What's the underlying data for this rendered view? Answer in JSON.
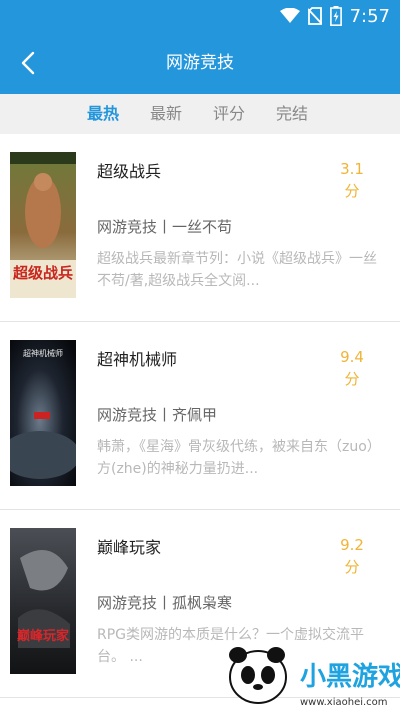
{
  "status_bar": {
    "time": "7:57"
  },
  "header": {
    "title": "网游竞技"
  },
  "tabs": [
    {
      "label": "最热",
      "active": true
    },
    {
      "label": "最新",
      "active": false
    },
    {
      "label": "评分",
      "active": false
    },
    {
      "label": "完结",
      "active": false
    }
  ],
  "books": [
    {
      "title": "超级战兵",
      "score_value": "3.1",
      "score_unit": "分",
      "meta": "网游竞技丨一丝不苟",
      "desc": "超级战兵最新章节列：小说《超级战兵》一丝不苟/著,超级战兵全文阅...",
      "cover_text": "超级战兵"
    },
    {
      "title": "超神机械师",
      "score_value": "9.4",
      "score_unit": "分",
      "meta": "网游竞技丨齐佩甲",
      "desc": "韩萧，《星海》骨灰级代练，被来自东（zuo）方(zhe)的神秘力量扔进...",
      "cover_text": "超神机械师"
    },
    {
      "title": "巅峰玩家",
      "score_value": "9.2",
      "score_unit": "分",
      "meta": "网游竞技丨孤枫枭寒",
      "desc": "RPG类网游的本质是什么？一个虚拟交流平台。 ...",
      "cover_text": "巅峰玩家"
    }
  ],
  "watermark": {
    "brand": "小黑游戏",
    "url": "www.xiaohei.com"
  },
  "colors": {
    "primary": "#2496dc",
    "score": "#f0b437"
  }
}
